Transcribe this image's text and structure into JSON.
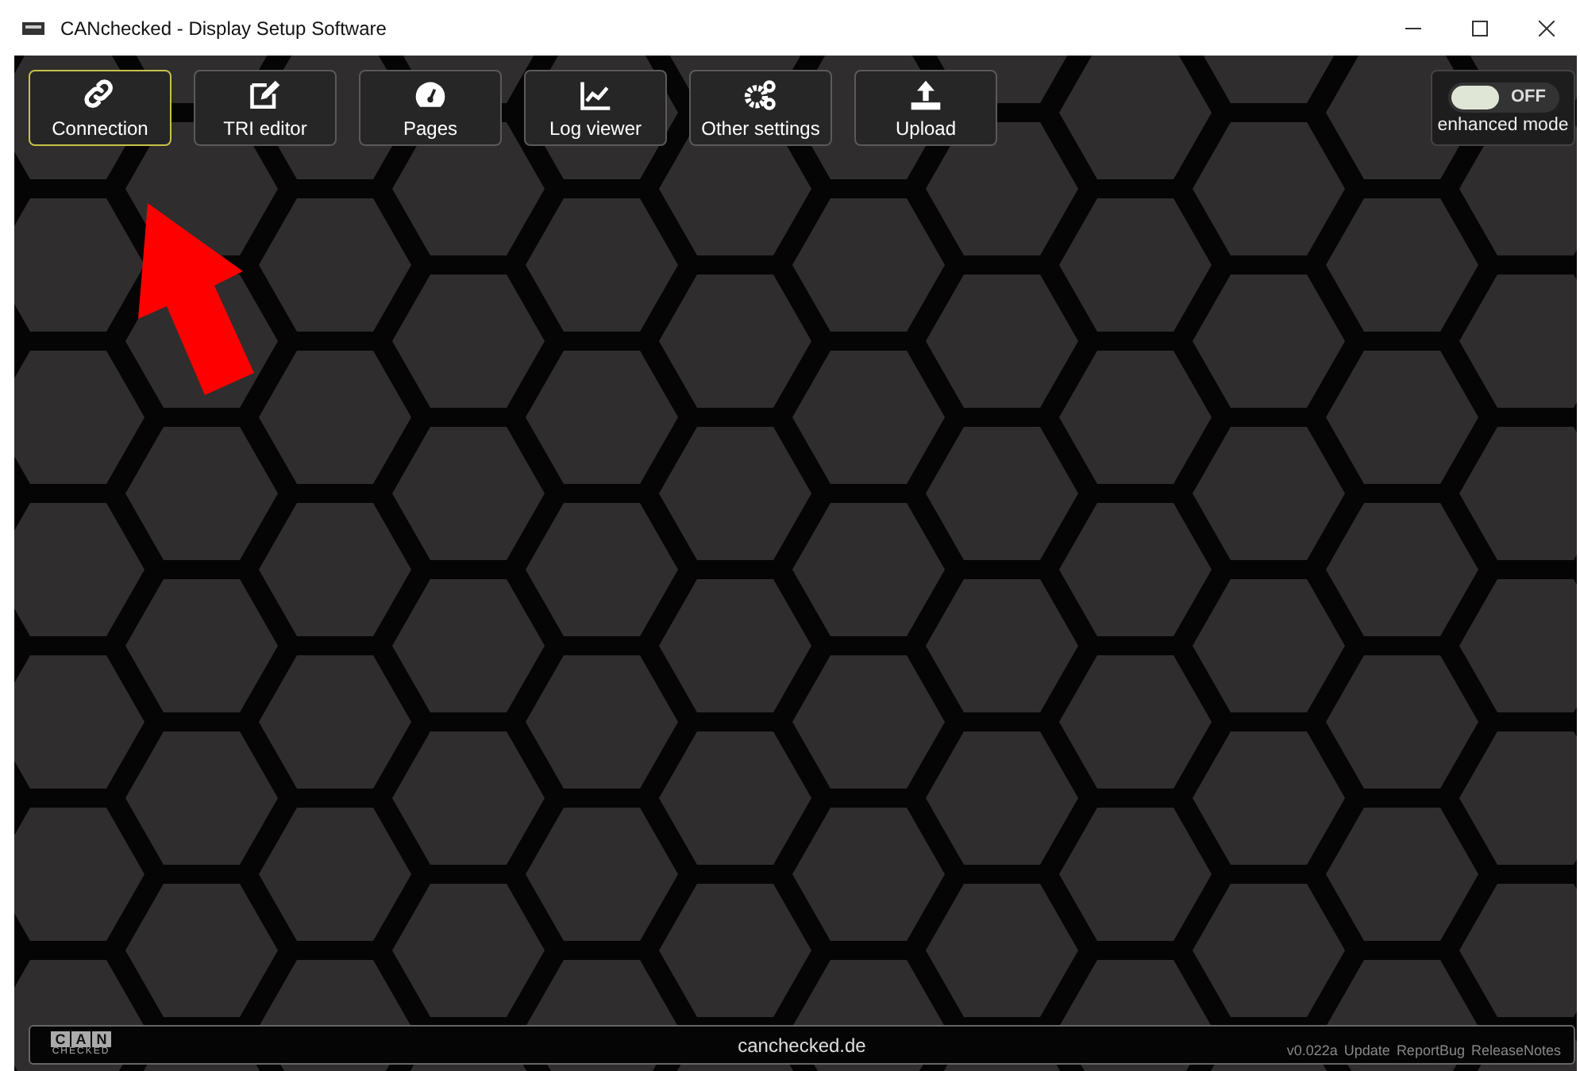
{
  "window": {
    "title": "CANchecked - Display Setup Software"
  },
  "toolbar": [
    {
      "kind": "link",
      "label": "Connection",
      "selected": true
    },
    {
      "kind": "edit",
      "label": "TRI editor",
      "selected": false
    },
    {
      "kind": "gauge",
      "label": "Pages",
      "selected": false
    },
    {
      "kind": "chart",
      "label": "Log viewer",
      "selected": false
    },
    {
      "kind": "gears",
      "label": "Other settings",
      "selected": false
    },
    {
      "kind": "upload",
      "label": "Upload",
      "selected": false
    }
  ],
  "enhanced_mode": {
    "on": false,
    "state_label": "OFF",
    "label": "enhanced mode"
  },
  "footer": {
    "logo_top": [
      "C",
      "A",
      "N"
    ],
    "logo_bottom": "CHECKED",
    "site": "canchecked.de",
    "version": "v0.022a",
    "links": [
      "Update",
      "ReportBug",
      "ReleaseNotes"
    ]
  }
}
